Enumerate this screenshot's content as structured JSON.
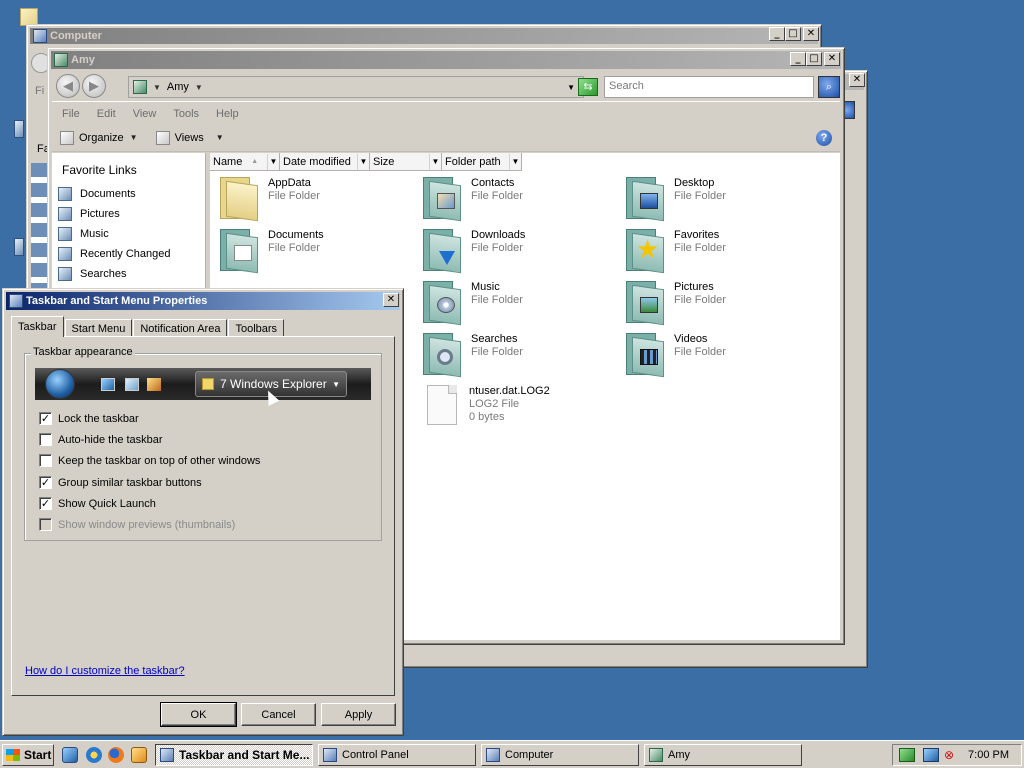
{
  "windows": {
    "computer": {
      "title": "Computer"
    },
    "control_panel": {
      "partial_label": "Fa"
    },
    "amy": {
      "title": "Amy",
      "address": "Amy",
      "search_placeholder": "Search",
      "menu": [
        "File",
        "Edit",
        "View",
        "Tools",
        "Help"
      ],
      "toolbar": {
        "organize": "Organize",
        "views": "Views"
      },
      "favorite_links_title": "Favorite Links",
      "favorite_links": [
        "Documents",
        "Pictures",
        "Music",
        "Recently Changed",
        "Searches"
      ],
      "columns": [
        "Name",
        "Date modified",
        "Size",
        "Folder path"
      ],
      "files": [
        {
          "name": "AppData",
          "type": "File Folder",
          "icon": "folder-icon"
        },
        {
          "name": "Contacts",
          "type": "File Folder",
          "icon": "contacts-folder-icon"
        },
        {
          "name": "Desktop",
          "type": "File Folder",
          "icon": "desktop-folder-icon"
        },
        {
          "name": "Documents",
          "type": "File Folder",
          "icon": "documents-folder-icon"
        },
        {
          "name": "Downloads",
          "type": "File Folder",
          "icon": "downloads-folder-icon"
        },
        {
          "name": "Favorites",
          "type": "File Folder",
          "icon": "favorites-folder-icon"
        },
        {
          "name": "Music",
          "type": "File Folder",
          "icon": "music-folder-icon"
        },
        {
          "name": "Pictures",
          "type": "File Folder",
          "icon": "pictures-folder-icon"
        },
        {
          "name": "Searches",
          "type": "File Folder",
          "icon": "searches-folder-icon"
        },
        {
          "name": "Videos",
          "type": "File Folder",
          "icon": "videos-folder-icon"
        },
        {
          "name": "ntuser.dat.LOG2",
          "type": "LOG2 File",
          "size": "0 bytes",
          "icon": "file-icon"
        }
      ]
    }
  },
  "dialog": {
    "title": "Taskbar and Start Menu Properties",
    "tabs": [
      "Taskbar",
      "Start Menu",
      "Notification Area",
      "Toolbars"
    ],
    "group_label": "Taskbar appearance",
    "preview_button": "7 Windows Explorer",
    "checkboxes": [
      {
        "label": "Lock the taskbar",
        "checked": "✓"
      },
      {
        "label": "Auto-hide the taskbar",
        "checked": ""
      },
      {
        "label": "Keep the taskbar on top of other windows",
        "checked": ""
      },
      {
        "label": "Group similar taskbar buttons",
        "checked": "✓"
      },
      {
        "label": "Show Quick Launch",
        "checked": "✓"
      },
      {
        "label": "Show window previews (thumbnails)",
        "checked": ""
      }
    ],
    "help_link": "How do I customize the taskbar?",
    "buttons": {
      "ok": "OK",
      "cancel": "Cancel",
      "apply": "Apply"
    }
  },
  "taskbar": {
    "start": "Start",
    "buttons": [
      "Taskbar and Start Me...",
      "Control Panel",
      "Computer",
      "Amy"
    ],
    "clock": "7:00 PM"
  },
  "colors": {
    "desktop": "#3a6ea5",
    "active_title": "#0a246a",
    "link": "#0000c8"
  }
}
